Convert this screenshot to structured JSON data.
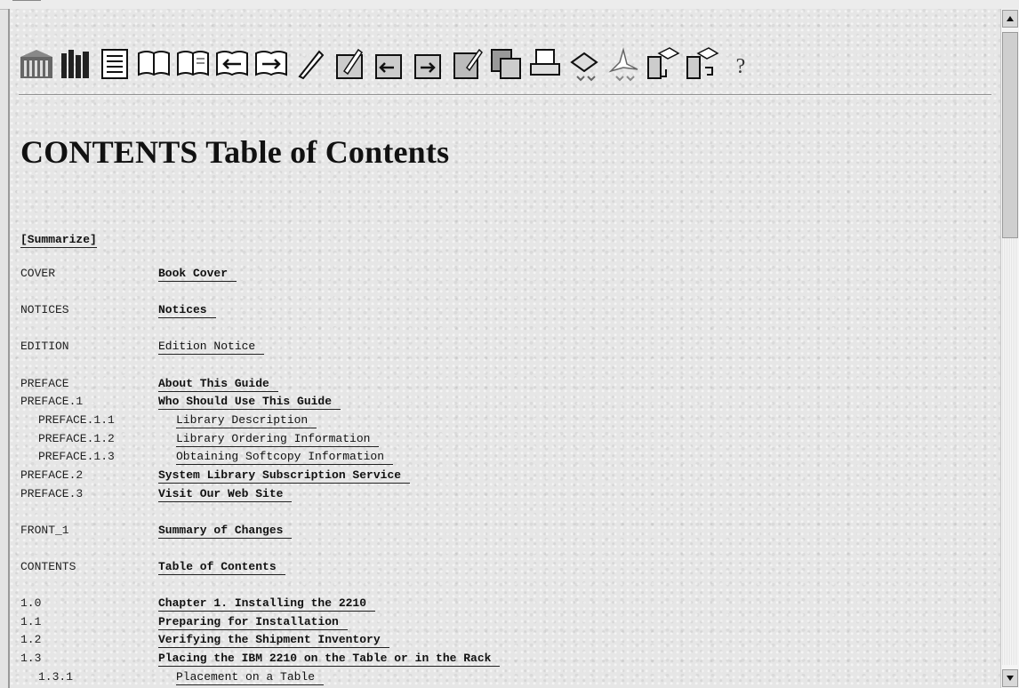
{
  "toolbar": {
    "icons": [
      "bookshelf-icon",
      "library-icon",
      "book-summary-icon",
      "open-book-icon",
      "open-book-2-icon",
      "previous-topic-icon",
      "next-topic-icon",
      "search-pen-icon",
      "book-search-icon",
      "book-search-prev-icon",
      "book-search-next-icon",
      "notes-icon",
      "copy-icon",
      "print-icon",
      "download-icon",
      "pdf-icon",
      "handheld-download-icon",
      "handheld-sync-icon",
      "help-icon"
    ]
  },
  "page": {
    "title": "CONTENTS Table of Contents"
  },
  "summarize_label": "[Summarize]",
  "toc": [
    {
      "id": "COVER",
      "title": "Book Cover",
      "bold": true,
      "level": 0
    },
    {
      "id": "NOTICES",
      "title": "Notices",
      "bold": true,
      "level": 0
    },
    {
      "id": "EDITION",
      "title": "Edition Notice",
      "bold": false,
      "level": 0
    },
    {
      "id": "PREFACE",
      "title": "About This Guide",
      "bold": true,
      "level": 0
    },
    {
      "id": "PREFACE.1",
      "title": "Who Should Use This Guide",
      "bold": true,
      "level": 0
    },
    {
      "id": "PREFACE.1.1",
      "title": "Library Description",
      "bold": false,
      "level": 1
    },
    {
      "id": "PREFACE.1.2",
      "title": "Library Ordering Information",
      "bold": false,
      "level": 1
    },
    {
      "id": "PREFACE.1.3",
      "title": "Obtaining Softcopy Information",
      "bold": false,
      "level": 1
    },
    {
      "id": "PREFACE.2",
      "title": "System Library Subscription Service",
      "bold": true,
      "level": 0
    },
    {
      "id": "PREFACE.3",
      "title": "Visit Our Web Site",
      "bold": true,
      "level": 0
    },
    {
      "id": "FRONT_1",
      "title": "Summary of Changes",
      "bold": true,
      "level": 0
    },
    {
      "id": "CONTENTS",
      "title": "Table of Contents",
      "bold": true,
      "level": 0
    },
    {
      "id": "1.0",
      "title": "Chapter 1.  Installing the 2210",
      "bold": true,
      "level": 0
    },
    {
      "id": "1.1",
      "title": "Preparing for Installation",
      "bold": true,
      "level": 0
    },
    {
      "id": "1.2",
      "title": "Verifying the Shipment Inventory",
      "bold": true,
      "level": 0
    },
    {
      "id": "1.3",
      "title": "Placing the IBM 2210 on the Table or in the Rack",
      "bold": true,
      "level": 0
    },
    {
      "id": "1.3.1",
      "title": "Placement on a Table",
      "bold": false,
      "level": 1
    }
  ]
}
